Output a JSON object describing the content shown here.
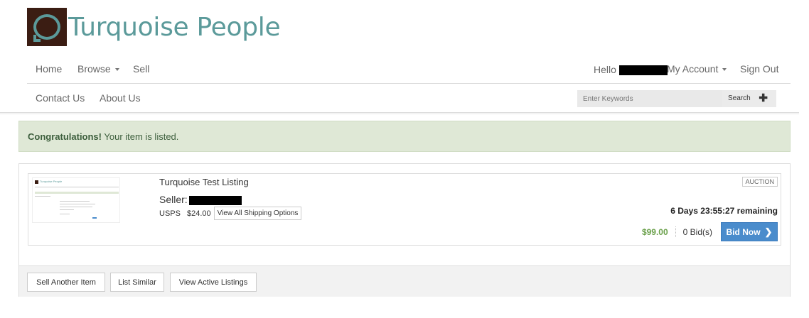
{
  "brand": {
    "name": "Turquoise People"
  },
  "nav": {
    "home": "Home",
    "browse": "Browse",
    "sell": "Sell",
    "hello": "Hello",
    "my_account": "My Account",
    "sign_out": "Sign Out",
    "contact_us": "Contact Us",
    "about_us": "About Us"
  },
  "search": {
    "placeholder": "Enter Keywords",
    "button": "Search",
    "plus_icon": "plus-icon"
  },
  "alert": {
    "strong": "Congratulations!",
    "text": " Your item is listed."
  },
  "listing": {
    "title": "Turquoise Test Listing",
    "seller_label": "Seller:",
    "carrier": "USPS",
    "shipping_price": "$24.00",
    "shipping_button": "View All Shipping Options",
    "type_badge": "AUCTION",
    "time_remaining": "6 Days 23:55:27 remaining",
    "price": "$99.00",
    "bids": "0 Bid(s)",
    "bid_button": "Bid Now",
    "thumbnail_title": "Turquoise People"
  },
  "actions": {
    "sell_another": "Sell Another Item",
    "list_similar": "List Similar",
    "view_active": "View Active Listings"
  },
  "colors": {
    "brand_teal": "#5b9a9a",
    "brand_dark": "#3b1d13",
    "success_bg": "#dfe8d6",
    "price_green": "#6aa04a",
    "primary_blue": "#4a8ccc"
  }
}
